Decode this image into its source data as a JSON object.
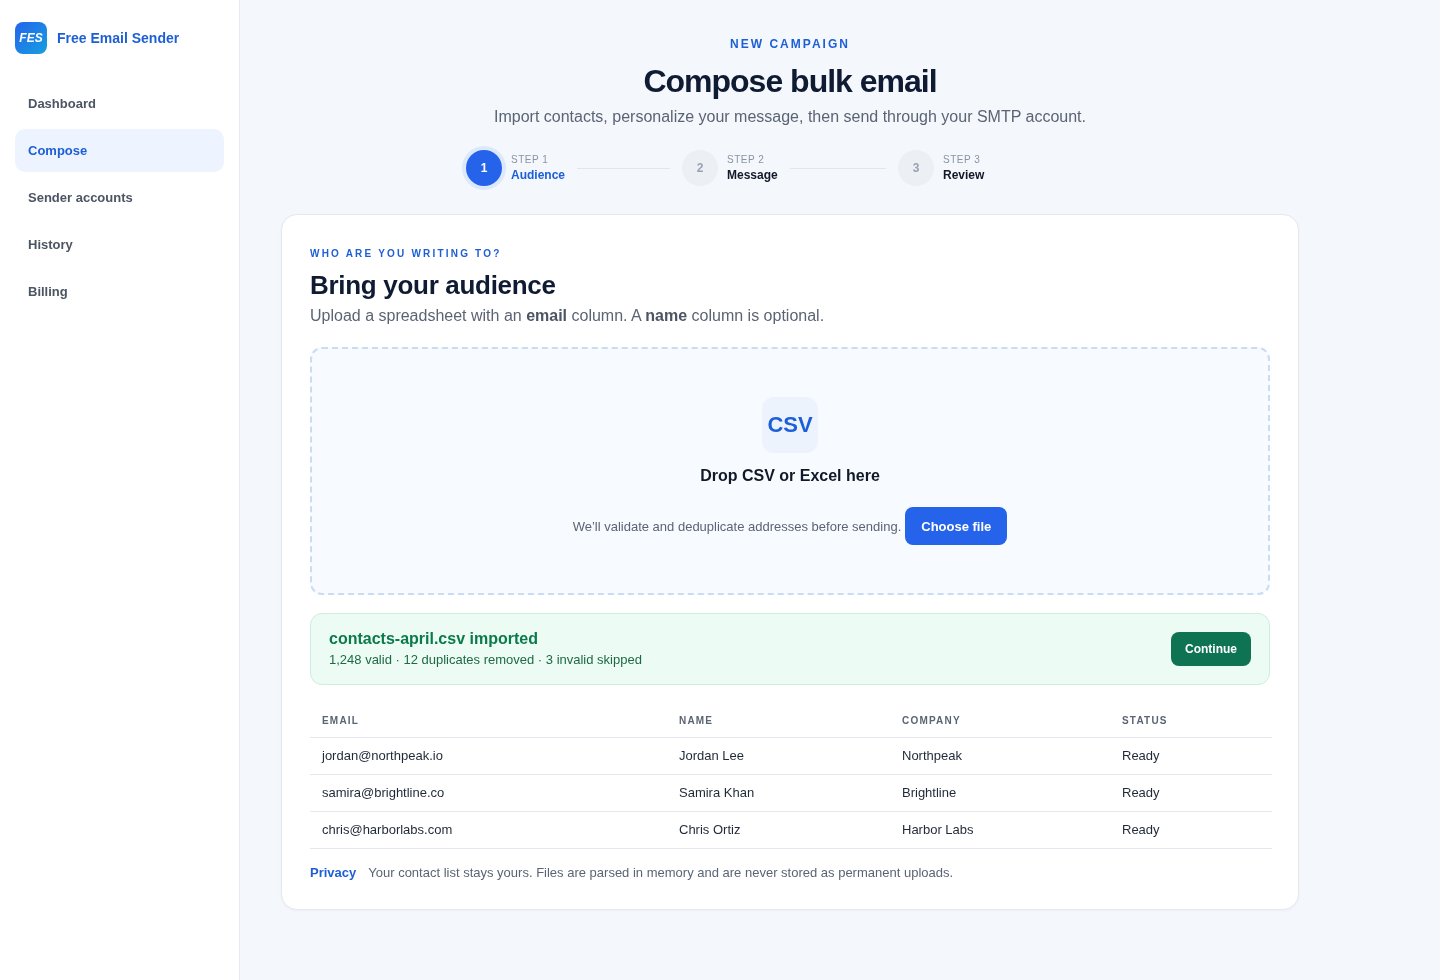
{
  "sidebar": {
    "brand": {
      "logo_text": "FES",
      "name": "Free Email Sender"
    },
    "items": [
      {
        "label": "Dashboard",
        "selected": false
      },
      {
        "label": "Compose",
        "selected": true
      },
      {
        "label": "Sender accounts",
        "selected": false
      },
      {
        "label": "History",
        "selected": false
      },
      {
        "label": "Billing",
        "selected": false
      }
    ]
  },
  "header": {
    "eyebrow": "NEW CAMPAIGN",
    "title": "Compose bulk email",
    "subtitle": "Import contacts, personalize your message, then send through your SMTP account."
  },
  "stepper": [
    {
      "number": "1",
      "caption": "STEP 1",
      "label": "Audience",
      "active": true
    },
    {
      "number": "2",
      "caption": "STEP 2",
      "label": "Message",
      "active": false
    },
    {
      "number": "3",
      "caption": "STEP 3",
      "label": "Review",
      "active": false
    }
  ],
  "card": {
    "eyebrow": "WHO ARE YOU WRITING TO?",
    "title": "Bring your audience",
    "description": "Upload a spreadsheet with an **email** column. A **name** column is optional.",
    "dropzone": {
      "file_type": "CSV",
      "title": "Drop CSV or Excel here",
      "hint": "We’ll validate and deduplicate addresses before sending.",
      "button": "Choose file"
    },
    "import_result": {
      "title": "contacts-april.csv imported",
      "summary": "1,248 valid · 12 duplicates removed · 3 invalid skipped",
      "button": "Continue"
    },
    "table": {
      "columns": [
        "EMAIL",
        "NAME",
        "COMPANY",
        "STATUS"
      ],
      "rows": [
        [
          "jordan@northpeak.io",
          "Jordan Lee",
          "Northpeak",
          "Ready"
        ],
        [
          "samira@brightline.co",
          "Samira Khan",
          "Brightline",
          "Ready"
        ],
        [
          "chris@harborlabs.com",
          "Chris Ortiz",
          "Harbor Labs",
          "Ready"
        ]
      ]
    },
    "footer": {
      "link": "Privacy",
      "text": "Your contact list stays yours. Files are parsed in memory and are never stored as permanent uploads."
    }
  }
}
